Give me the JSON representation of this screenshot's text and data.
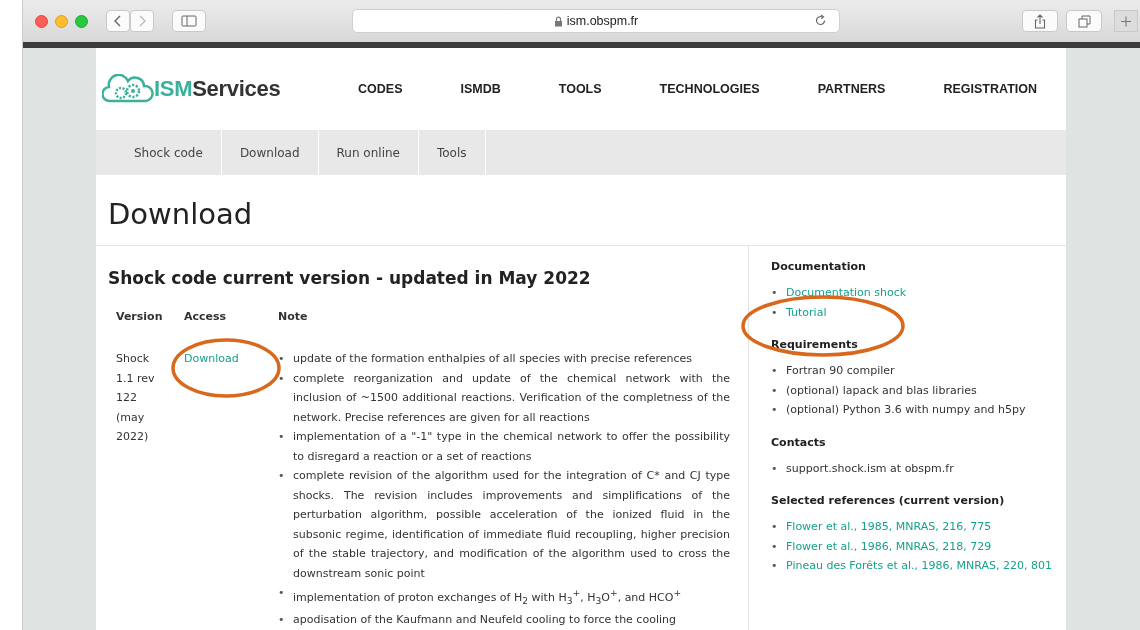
{
  "browser": {
    "url": "ism.obspm.fr"
  },
  "site": {
    "logo": {
      "prefix": "ISM",
      "suffix": "Services"
    },
    "nav": [
      "CODES",
      "ISMDB",
      "TOOLS",
      "TECHNOLOGIES",
      "PARTNERS",
      "REGISTRATION"
    ],
    "subnav": [
      "Shock code",
      "Download",
      "Run online",
      "Tools"
    ]
  },
  "page_title": "Download",
  "bullet": "•",
  "main": {
    "heading": "Shock code current version - updated in May 2022",
    "columns": [
      "Version",
      "Access",
      "Note"
    ],
    "rows": [
      {
        "version": "Shock 1.1 rev 122 (may 2022)",
        "access": "Download",
        "notes": [
          "update of the formation enthalpies of all species with precise references",
          "complete reorganization and update of the chemical network with the inclusion of ~1500 additional reactions. Verification of the completness of the network. Precise references are given for all reactions",
          "implementation of a \"-1\" type in the chemical network to offer the possibility to disregard a reaction or a set of reactions",
          "complete revision of the algorithm used for the integration of C* and CJ type shocks. The revision includes improvements and simplifications of the perturbation algorithm, possible acceleration of the ionized fluid in the subsonic regime, identification of immediate fluid recoupling, higher precision of the stable trajectory, and modification of the algorithm used to cross the downstream sonic point",
          "implementation of proton exchanges of H$_{2}$ with H$_{3}$$^{+}$, H$_{3}$O$^{+}$, and HCO$^{+}$",
          "apodisation of the Kaufmann and Neufeld cooling to force the cooling"
        ]
      }
    ]
  },
  "sidebar": [
    {
      "title": "Documentation",
      "items": [
        {
          "kind": "link",
          "text": "Documentation shock"
        },
        {
          "kind": "link",
          "text": "Tutorial"
        }
      ]
    },
    {
      "title": "Requirements",
      "items": [
        {
          "kind": "text",
          "text": "Fortran 90 compiler"
        },
        {
          "kind": "text",
          "text": "(optional) lapack and blas libraries"
        },
        {
          "kind": "text",
          "text": "(optional) Python 3.6 with numpy and h5py"
        }
      ]
    },
    {
      "title": "Contacts",
      "items": [
        {
          "kind": "text",
          "text": "support.shock.ism at obspm.fr"
        }
      ]
    },
    {
      "title": "Selected references (current version)",
      "items": [
        {
          "kind": "link",
          "text": "Flower et al., 1985, MNRAS, 216, 775"
        },
        {
          "kind": "link",
          "text": "Flower et al., 1986, MNRAS, 218, 729"
        },
        {
          "kind": "link",
          "text": "Pineau des Forêts et al., 1986, MNRAS, 220, 801"
        }
      ]
    }
  ]
}
